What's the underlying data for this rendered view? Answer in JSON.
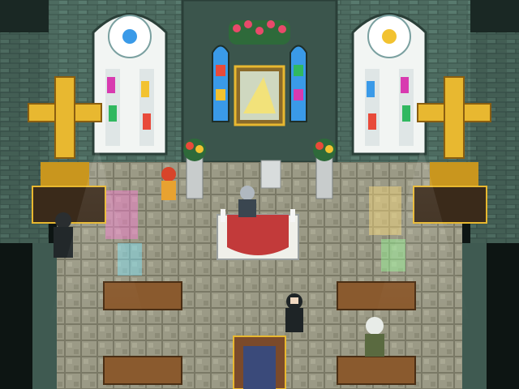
{
  "scene": {
    "title": "",
    "palette": {
      "wall": "#4d6b60",
      "wall_dark": "#2f4640",
      "floor": "#9b9a86",
      "floor_line": "#6f6e5e",
      "gold": "#e8b830",
      "altar_cloth": "#c23a3a",
      "pew": "#8a5a2e",
      "carpet": "#7b4a2a"
    },
    "icons": [
      "stained-glass-window",
      "gold-cross",
      "pew",
      "altar",
      "candle",
      "flower-vase",
      "priest",
      "nun",
      "hero",
      "cleric"
    ]
  }
}
